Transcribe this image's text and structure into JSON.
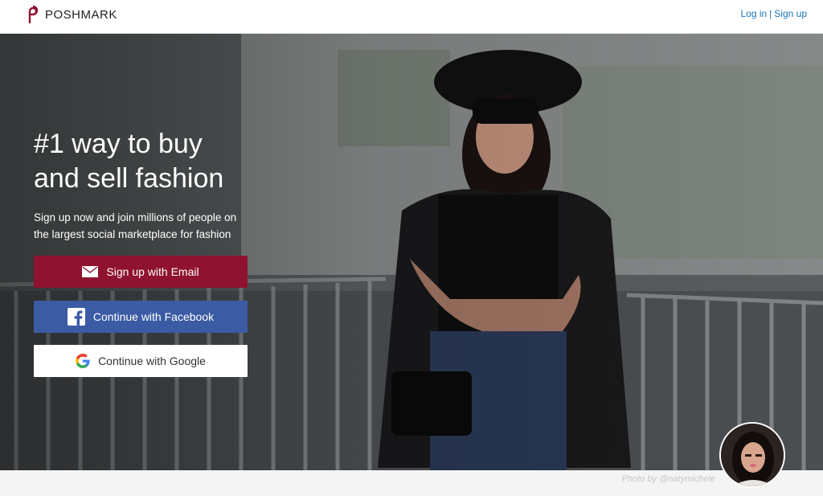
{
  "header": {
    "brand": "POSHMARK",
    "login_label": "Log in",
    "separator": "|",
    "signup_label": "Sign up"
  },
  "hero": {
    "headline_line1": "#1 way to buy",
    "headline_line2": "and sell fashion",
    "subline_line1": "Sign up now and join millions of people on",
    "subline_line2": "the largest social marketplace for fashion"
  },
  "buttons": {
    "email_label": "Sign up with Email",
    "facebook_label": "Continue with Facebook",
    "google_label": "Continue with Google"
  },
  "photo": {
    "credit": "Photo by @natymichele"
  },
  "colors": {
    "brand": "#8f1230",
    "facebook": "#3b5ba4",
    "link": "#1a73b8"
  },
  "icons": [
    "poshmark-logo-icon",
    "envelope-icon",
    "facebook-icon",
    "google-icon"
  ]
}
